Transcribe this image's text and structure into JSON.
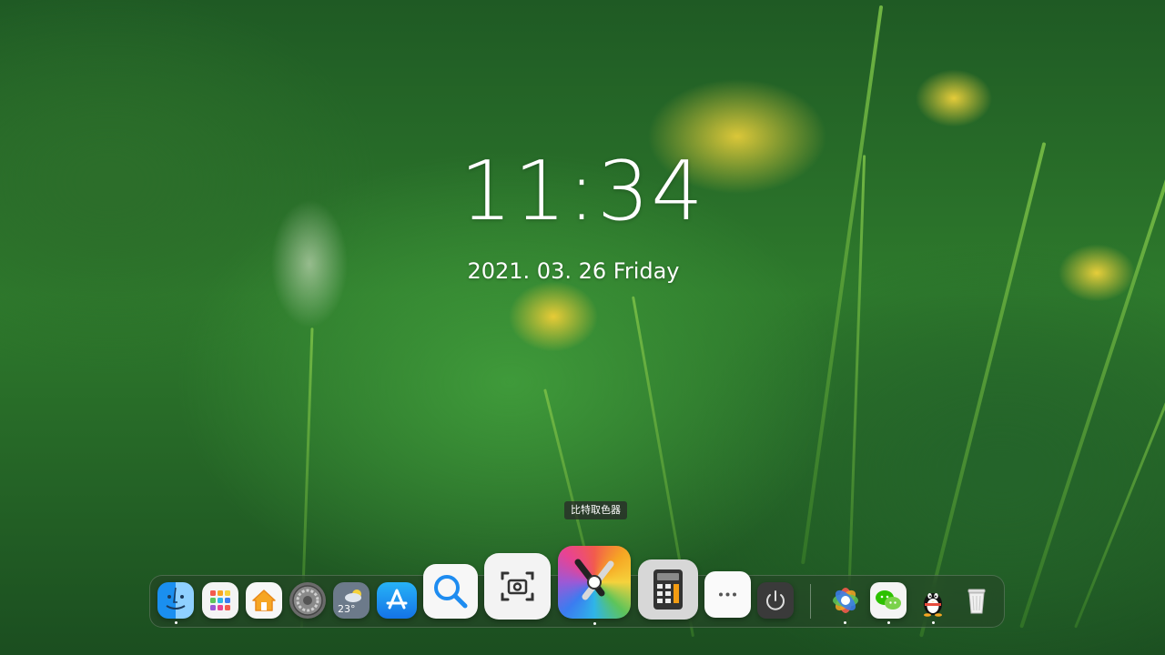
{
  "lockscreen": {
    "time": "11:34",
    "date": "2021. 03. 26  Friday"
  },
  "tooltip": "比特取色器",
  "weather_widget": {
    "temp": "23°"
  },
  "dock": {
    "apps": [
      {
        "name": "Finder",
        "icon": "finder-icon"
      },
      {
        "name": "Launchpad",
        "icon": "launchpad-icon"
      },
      {
        "name": "Home",
        "icon": "home-icon"
      },
      {
        "name": "System Preferences",
        "icon": "settings-icon"
      },
      {
        "name": "Weather",
        "icon": "weather-icon"
      },
      {
        "name": "App Store",
        "icon": "app-store-icon"
      },
      {
        "name": "Search",
        "icon": "search-icon"
      },
      {
        "name": "Screenshot",
        "icon": "screenshot-icon"
      },
      {
        "name": "比特取色器",
        "icon": "color-picker-icon"
      },
      {
        "name": "Calculator",
        "icon": "calculator-icon"
      },
      {
        "name": "More",
        "icon": "more-icon"
      },
      {
        "name": "Power",
        "icon": "power-icon"
      },
      {
        "name": "Photos",
        "icon": "photos-icon"
      },
      {
        "name": "WeChat",
        "icon": "wechat-icon"
      },
      {
        "name": "QQ",
        "icon": "qq-icon"
      },
      {
        "name": "Trash",
        "icon": "trash-icon"
      }
    ]
  },
  "colors": {
    "accent_blue": "#1e8cf0",
    "dock_bg": "#283c28",
    "flower_yellow": "#f5d23c"
  }
}
